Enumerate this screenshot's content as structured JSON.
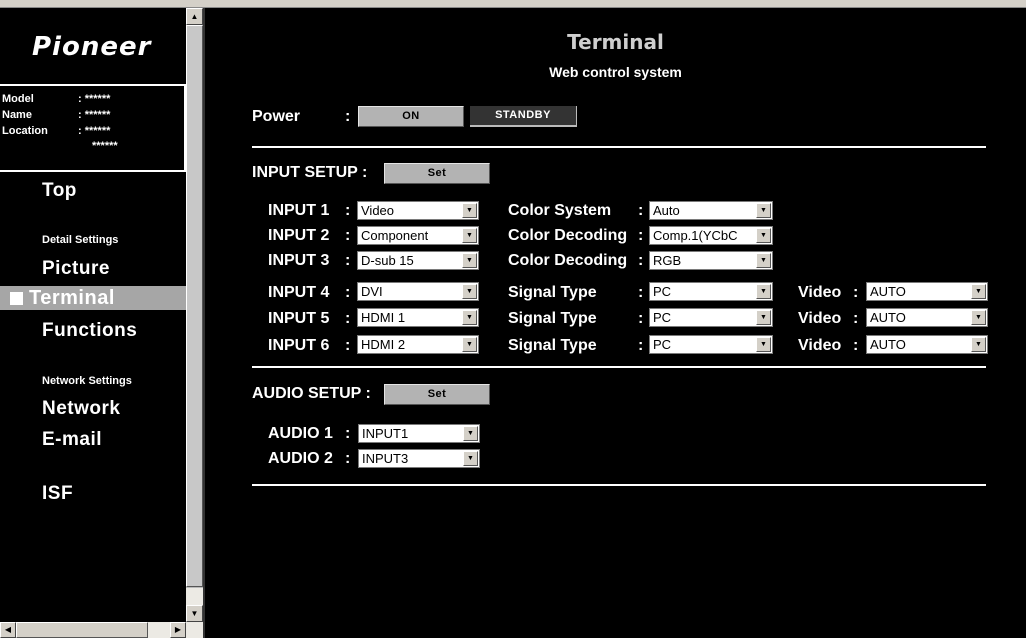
{
  "nav": {
    "logo": "Pioneer",
    "info": {
      "model_label": "Model",
      "model_value": ": ******",
      "name_label": "Name",
      "name_value": ": ******",
      "location_label": "Location",
      "location_value": ": ******",
      "location_value2": "******"
    },
    "top": "Top",
    "detail_settings": "Detail Settings",
    "picture": "Picture",
    "terminal": "Terminal",
    "functions": "Functions",
    "network_settings": "Network Settings",
    "network": "Network",
    "email": "E-mail",
    "isf": "ISF"
  },
  "header": {
    "title": "Terminal",
    "subtitle": "Web control system"
  },
  "power": {
    "label": "Power",
    "colon": ":",
    "on": "ON",
    "standby": "STANDBY"
  },
  "input_setup": {
    "label": "INPUT SETUP :",
    "set": "Set",
    "rows": [
      {
        "label": "INPUT 1",
        "value": "Video",
        "attr_label": "Color System",
        "attr_value": "Auto"
      },
      {
        "label": "INPUT 2",
        "value": "Component",
        "attr_label": "Color Decoding",
        "attr_value": "Comp.1(YCbC"
      },
      {
        "label": "INPUT 3",
        "value": "D-sub 15",
        "attr_label": "Color Decoding",
        "attr_value": "RGB"
      },
      {
        "label": "INPUT 4",
        "value": "DVI",
        "attr_label": "Signal Type",
        "attr_value": "PC",
        "video_label": "Video",
        "video_value": "AUTO"
      },
      {
        "label": "INPUT 5",
        "value": "HDMI 1",
        "attr_label": "Signal Type",
        "attr_value": "PC",
        "video_label": "Video",
        "video_value": "AUTO"
      },
      {
        "label": "INPUT 6",
        "value": "HDMI 2",
        "attr_label": "Signal Type",
        "attr_value": "PC",
        "video_label": "Video",
        "video_value": "AUTO"
      }
    ]
  },
  "audio_setup": {
    "label": "AUDIO SETUP :",
    "set": "Set",
    "rows": [
      {
        "label": "AUDIO 1",
        "value": "INPUT1"
      },
      {
        "label": "AUDIO 2",
        "value": "INPUT3"
      }
    ]
  }
}
